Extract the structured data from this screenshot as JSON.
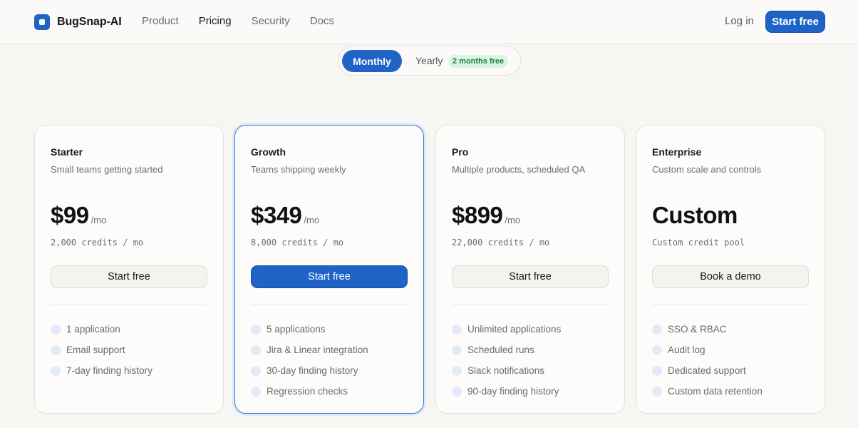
{
  "header": {
    "brand": "BugSnap-AI",
    "nav": [
      "Product",
      "Pricing",
      "Security",
      "Docs"
    ],
    "active_nav": "Pricing",
    "login": "Log in",
    "cta": "Start free"
  },
  "billing_toggle": {
    "monthly": "Monthly",
    "yearly": "Yearly",
    "yearly_badge": "2 months free",
    "selected": "Monthly"
  },
  "plans": [
    {
      "name": "Starter",
      "tagline": "Small teams getting started",
      "price": "$99",
      "period": "/mo",
      "credits": "2,000 credits / mo",
      "button": "Start free",
      "features": [
        "1 application",
        "Email support",
        "7-day finding history"
      ]
    },
    {
      "name": "Growth",
      "tagline": "Teams shipping weekly",
      "price": "$349",
      "period": "/mo",
      "credits": "8,000 credits / mo",
      "button": "Start free",
      "features": [
        "5 applications",
        "Jira & Linear integration",
        "30-day finding history",
        "Regression checks"
      ]
    },
    {
      "name": "Pro",
      "tagline": "Multiple products, scheduled QA",
      "price": "$899",
      "period": "/mo",
      "credits": "22,000 credits / mo",
      "button": "Start free",
      "features": [
        "Unlimited applications",
        "Scheduled runs",
        "Slack notifications",
        "90-day finding history"
      ]
    },
    {
      "name": "Enterprise",
      "tagline": "Custom scale and controls",
      "price": "Custom",
      "period": "",
      "credits": "Custom credit pool",
      "button": "Book a demo",
      "features": [
        "SSO & RBAC",
        "Audit log",
        "Dedicated support",
        "Custom data retention"
      ]
    }
  ],
  "colors": {
    "accent": "#1f63c6",
    "badge_bg": "#d9f5e2",
    "badge_text": "#1b7f3f"
  }
}
